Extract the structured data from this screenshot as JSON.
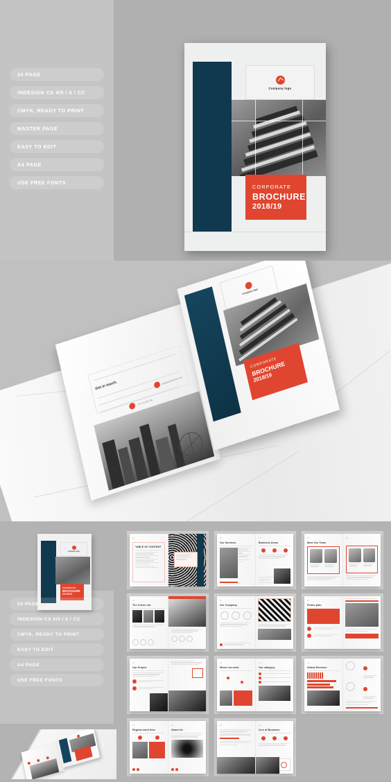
{
  "hero": {
    "features": [
      "24 PAGE",
      "INDESIGN CS 4/5 / 6 / CC",
      "CMYK, READY TO PRINT",
      "MASTER PAGE",
      "EASY TO EDIT",
      "A4 PAGE",
      "USE FREE FONTS"
    ],
    "cover": {
      "logo_caption": "Company logo",
      "title_line1": "CORPORATE",
      "title_line2": "BROCHURE",
      "title_line3": "2018/19"
    }
  },
  "marble": {
    "back_cover": {
      "heading": "Get in touch.",
      "contacts": [
        "www.yourwebsite.com",
        "+00 123 456 789",
        "hello@yoursite.com"
      ]
    },
    "front_cover": {
      "logo_caption": "Company logo",
      "title_line1": "CORPORATE",
      "title_line2": "BROCHURE",
      "title_line3": "2018/19"
    }
  },
  "grid": {
    "features": [
      "24 PAGE",
      "INDESIGN CS 4/5 / 6 / CC",
      "CMYK, READY TO PRINT",
      "EASY TO EDIT",
      "A4 PAGE",
      "USE FREE FONTS"
    ],
    "mini_cover": {
      "logo_caption": "Company logo",
      "title_line1": "CORPORATE",
      "title_line2": "BROCHURE",
      "title_line3": "2018/19"
    },
    "spreads": [
      {
        "left_title": "TABLE OF CONTENT",
        "right_title": ""
      },
      {
        "left_title": "Our Services",
        "right_title": "Business Areas"
      },
      {
        "left_title": "Meet Our Team",
        "right_title": ""
      },
      {
        "left_title": "The Client List",
        "right_title": ""
      },
      {
        "left_title": "Our Company",
        "right_title": ""
      },
      {
        "left_title": "Future plan",
        "right_title": ""
      },
      {
        "left_title": "Our Project",
        "right_title": ""
      },
      {
        "left_title": "Where we work",
        "right_title": "Our category"
      },
      {
        "left_title": "Global Revenue",
        "right_title": ""
      },
      {
        "left_title": "Regular work time",
        "right_title": "About Us"
      },
      {
        "left_title": "",
        "right_title": "Line of Business"
      }
    ]
  },
  "colors": {
    "accent_red": "#e0462f",
    "teal": "#10384e",
    "bg_gray": "#b3b3b3",
    "panel_gray": "#c4c4c4"
  }
}
